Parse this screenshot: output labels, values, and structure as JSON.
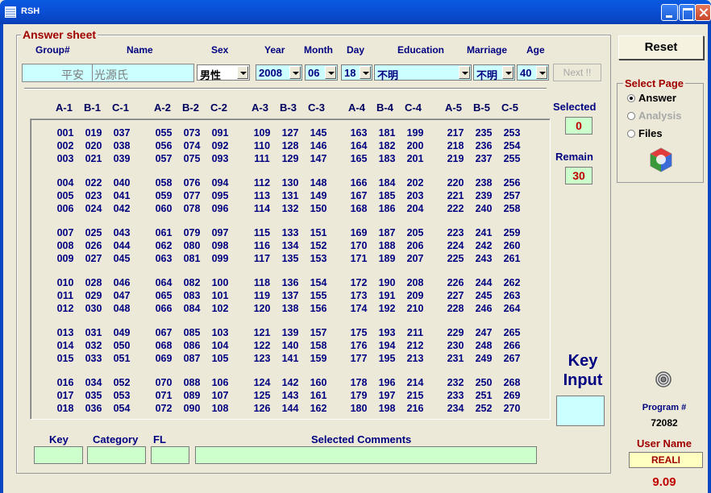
{
  "window": {
    "title": "RSH"
  },
  "sheet": {
    "legend": "Answer sheet",
    "headers": {
      "group": "Group#",
      "name": "Name",
      "sex": "Sex",
      "year": "Year",
      "month": "Month",
      "day": "Day",
      "education": "Education",
      "marriage": "Marriage",
      "age": "Age"
    },
    "name": {
      "first": "平安",
      "last": "光源氏"
    },
    "sex": "男性",
    "year": "2008",
    "month": "06",
    "day": "18",
    "education": "不明",
    "marriage": "不明",
    "age": "40",
    "next_label": "Next !!"
  },
  "columns": [
    "A-1",
    "B-1",
    "C-1",
    "A-2",
    "B-2",
    "C-2",
    "A-3",
    "B-3",
    "C-3",
    "A-4",
    "B-4",
    "C-4",
    "A-5",
    "B-5",
    "C-5"
  ],
  "counters": {
    "selected_label": "Selected",
    "selected": "0",
    "remain_label": "Remain",
    "remain": "30"
  },
  "key_input": {
    "line1": "Key",
    "line2": "Input"
  },
  "bottom": {
    "key": "Key",
    "category": "Category",
    "fl": "FL",
    "comments": "Selected Comments"
  },
  "right": {
    "reset": "Reset",
    "select_page": "Select Page",
    "options": [
      {
        "label": "Answer",
        "selected": true,
        "enabled": true
      },
      {
        "label": "Analysis",
        "selected": false,
        "enabled": false
      },
      {
        "label": "Files",
        "selected": false,
        "enabled": true
      }
    ],
    "program_label": "Program #",
    "program_num": "72082",
    "user_label": "User Name",
    "user_name": "REALI",
    "version": "9.09"
  },
  "colors": {
    "accent_red": "#a00000",
    "navy": "#000080",
    "cyan_field": "#ccffff",
    "green_field": "#ccffcc"
  },
  "grid_count": 270
}
